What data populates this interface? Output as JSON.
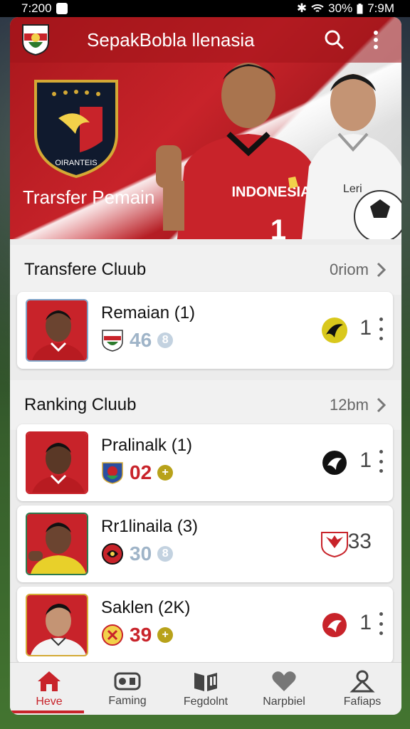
{
  "status_bar": {
    "time_left": "7:200",
    "battery": "30%",
    "time_right": "7:9M"
  },
  "app": {
    "title": "SepakBobla llenasia"
  },
  "hero": {
    "caption": "Trarsfer Pemain",
    "crest_text": "OIRANTEIS",
    "jersey_text": "INDONESIA",
    "jersey_number": "1",
    "second_jersey_text": "Leri"
  },
  "sections": {
    "transfer": {
      "title": "Transfere Cluub",
      "meta": "0riom"
    },
    "ranking": {
      "title": "Ranking Cluub",
      "meta": "12bm"
    }
  },
  "cards": [
    {
      "name": "Remaian (1)",
      "score": "46",
      "badge": "8",
      "rank": "1"
    },
    {
      "name": "Pralinalk (1)",
      "score": "02",
      "badge": "+",
      "rank": "1"
    },
    {
      "name": "Rr1linaila (3)",
      "score": "30",
      "badge": "8",
      "rank": "33"
    },
    {
      "name": "Saklen (2K)",
      "score": "39",
      "badge": "+",
      "rank": "1"
    }
  ],
  "nav": [
    {
      "label": "Heve",
      "icon": "home-icon"
    },
    {
      "label": "Faming",
      "icon": "gamepad-icon"
    },
    {
      "label": "Fegdolnt",
      "icon": "book-icon"
    },
    {
      "label": "Narpbiel",
      "icon": "heart-icon"
    },
    {
      "label": "Fafiaps",
      "icon": "person-icon"
    }
  ],
  "colors": {
    "accent": "#c8232a",
    "score_blue": "#9fb4c8",
    "score_red": "#c8232a",
    "badge_gold": "#b8a21a"
  }
}
